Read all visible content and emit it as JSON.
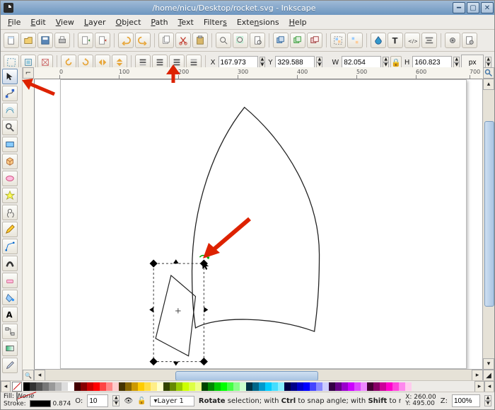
{
  "window": {
    "title": "/home/nicu/Desktop/rocket.svg - Inkscape"
  },
  "menu": {
    "file": "File",
    "edit": "Edit",
    "view": "View",
    "layer": "Layer",
    "object": "Object",
    "path": "Path",
    "text": "Text",
    "filters": "Filters",
    "extensions": "Extensions",
    "help": "Help"
  },
  "coords": {
    "x_label": "X",
    "x": "167.973",
    "y_label": "Y",
    "y": "329.588",
    "w_label": "W",
    "w": "82.054",
    "h_label": "H",
    "h": "160.823",
    "unit": "px"
  },
  "ruler": {
    "t0": "0",
    "t1": "100",
    "t2": "200",
    "t3": "300",
    "t4": "400",
    "t5": "500",
    "t6": "600",
    "t7": "700"
  },
  "status": {
    "fill_label": "Fill:",
    "fill_value": "None",
    "stroke_label": "Stroke:",
    "stroke_value": "0.874",
    "opacity_label": "O:",
    "opacity": "10",
    "layer": "Layer 1",
    "hint_pre": "Rotate",
    "hint_mid": " selection; with ",
    "hint_ctrl": "Ctrl",
    "hint_mid2": " to snap angle; with ",
    "hint_shift": "Shift",
    "hint_end": " to rotate .",
    "cursor_x_label": "X:",
    "cursor_x": "260.00",
    "cursor_y_label": "Y:",
    "cursor_y": "495.00",
    "zoom_label": "Z:",
    "zoom": "100%"
  }
}
